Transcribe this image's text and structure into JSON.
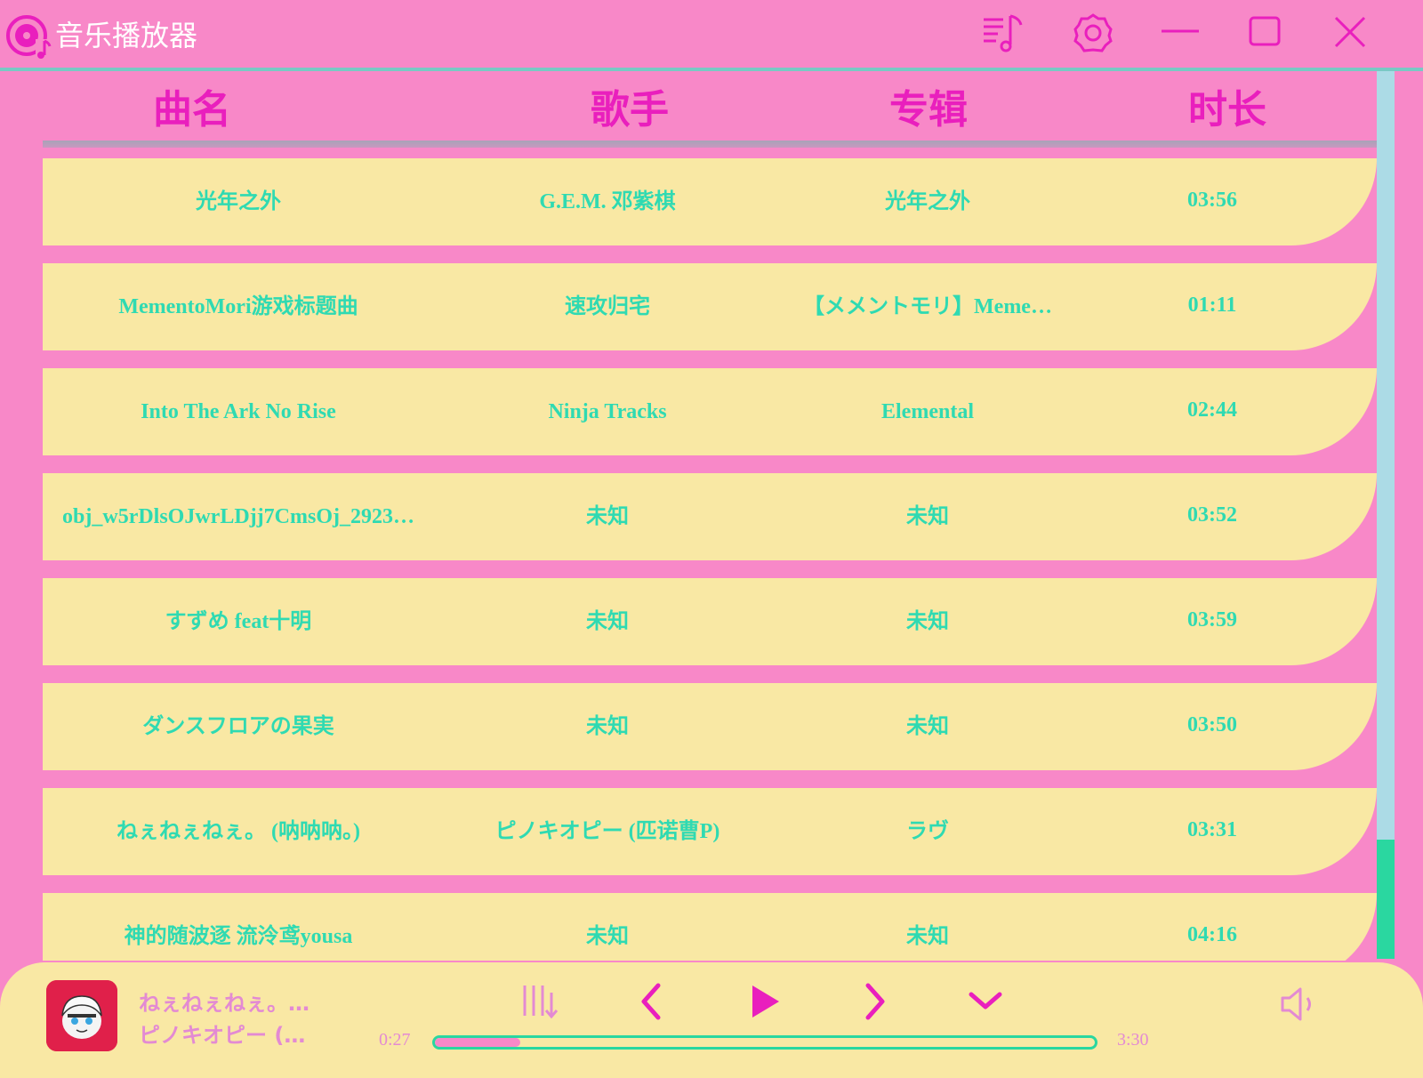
{
  "app": {
    "title": "音乐播放器"
  },
  "colors": {
    "background": "#f888c8",
    "row": "#f9e8a4",
    "row_text": "#2fdab2",
    "header_text": "#e91fbd",
    "accent": "#2ad7a0",
    "player_text": "#e38ad3"
  },
  "titlebar": {
    "icons": [
      "music-logo-icon",
      "playlist-icon",
      "settings-gear-icon",
      "minimize-icon",
      "maximize-icon",
      "close-icon"
    ]
  },
  "columns": {
    "title": "曲名",
    "artist": "歌手",
    "album": "专辑",
    "duration": "时长"
  },
  "songs": [
    {
      "title": "光年之外",
      "artist": "G.E.M. 邓紫棋",
      "album": "光年之外",
      "duration": "03:56"
    },
    {
      "title": "MementoMori游戏标题曲",
      "artist": "速攻归宅",
      "album": "【メメントモリ】Meme…",
      "duration": "01:11"
    },
    {
      "title": "Into The Ark No Rise",
      "artist": "Ninja Tracks",
      "album": "Elemental",
      "duration": "02:44"
    },
    {
      "title": "obj_w5rDlsOJwrLDjj7CmsOj_2923…",
      "artist": "未知",
      "album": "未知",
      "duration": "03:52"
    },
    {
      "title": "すずめ feat十明",
      "artist": "未知",
      "album": "未知",
      "duration": "03:59"
    },
    {
      "title": "ダンスフロアの果実",
      "artist": "未知",
      "album": "未知",
      "duration": "03:50"
    },
    {
      "title": "ねぇねぇねぇ。 (呐呐呐。)",
      "artist": "ピノキオピー (匹诺曹P)",
      "album": "ラヴ",
      "duration": "03:31"
    },
    {
      "title": "神的随波逐 流泠鸢yousa",
      "artist": "未知",
      "album": "未知",
      "duration": "04:16"
    }
  ],
  "player": {
    "now_title": "ねぇねぇねぇ。…",
    "now_artist": "ピノキオピー (…",
    "elapsed": "0:27",
    "total": "3:30",
    "progress": 0.13,
    "controls": [
      "equalizer-icon",
      "previous-icon",
      "play-icon",
      "next-icon",
      "collapse-chevron-icon",
      "volume-icon"
    ]
  }
}
